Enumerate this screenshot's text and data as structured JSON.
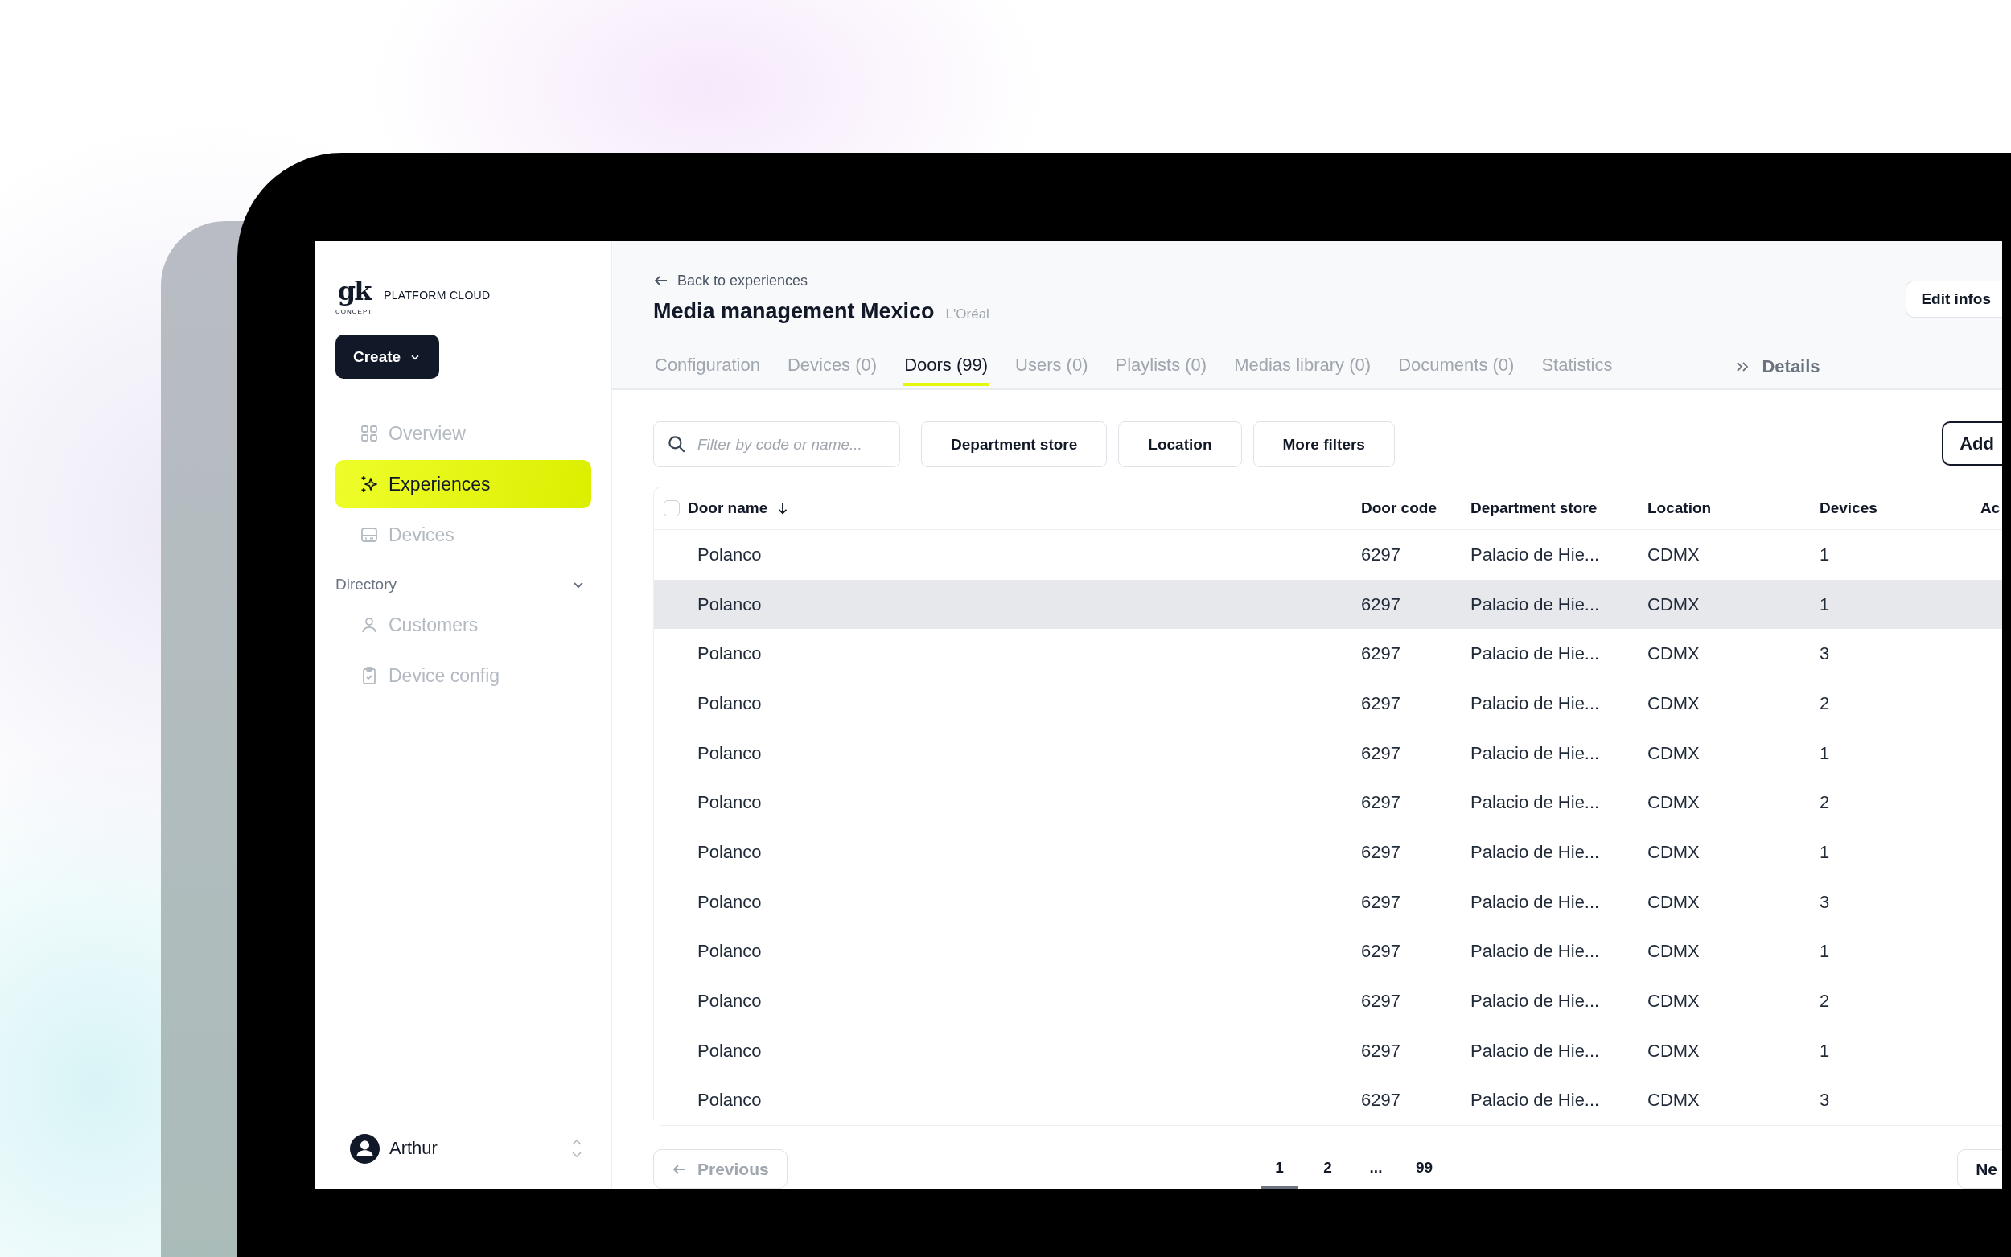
{
  "sidebar": {
    "logo": {
      "mark": "gk",
      "sub": "CONCEPT",
      "product": "PLATFORM CLOUD"
    },
    "create_button": "Create",
    "nav": [
      {
        "label": "Overview",
        "selected": false
      },
      {
        "label": "Experiences",
        "selected": true
      },
      {
        "label": "Devices",
        "selected": false
      }
    ],
    "section": {
      "label": "Directory",
      "expanded": true,
      "items": [
        {
          "label": "Customers",
          "selected": false
        },
        {
          "label": "Device config",
          "selected": false
        }
      ]
    },
    "user": {
      "name": "Arthur"
    }
  },
  "header": {
    "back_link": "Back to experiences",
    "title": "Media management Mexico",
    "subtitle": "L'Oréal",
    "edit_button": "Edit infos",
    "tabs": [
      {
        "label": "Configuration",
        "selected": false
      },
      {
        "label": "Devices (0)",
        "selected": false
      },
      {
        "label": "Doors (99)",
        "selected": true
      },
      {
        "label": "Users (0)",
        "selected": false
      },
      {
        "label": "Playlists (0)",
        "selected": false
      },
      {
        "label": "Medias library (0)",
        "selected": false
      },
      {
        "label": "Documents (0)",
        "selected": false
      },
      {
        "label": "Statistics",
        "selected": false
      }
    ],
    "details": "Details"
  },
  "filters": {
    "search": {
      "placeholder": "Filter by code or name..."
    },
    "buttons": [
      "Department store",
      "Location",
      "More filters"
    ],
    "add_button": "Add"
  },
  "table": {
    "select_all": {
      "checked": false
    },
    "columns": [
      {
        "label": "Door name",
        "sorted": true
      },
      {
        "label": "Door code",
        "sorted": false
      },
      {
        "label": "Department store",
        "sorted": false
      },
      {
        "label": "Location",
        "sorted": false
      },
      {
        "label": "Devices",
        "sorted": false
      },
      {
        "label": "Ac",
        "sorted": false
      }
    ],
    "rows": [
      {
        "cells": [
          "Polanco",
          "6297",
          "Palacio de Hie...",
          "CDMX",
          "1"
        ],
        "highlighted": false
      },
      {
        "cells": [
          "Polanco",
          "6297",
          "Palacio de Hie...",
          "CDMX",
          "1"
        ],
        "highlighted": true
      },
      {
        "cells": [
          "Polanco",
          "6297",
          "Palacio de Hie...",
          "CDMX",
          "3"
        ],
        "highlighted": false
      },
      {
        "cells": [
          "Polanco",
          "6297",
          "Palacio de Hie...",
          "CDMX",
          "2"
        ],
        "highlighted": false
      },
      {
        "cells": [
          "Polanco",
          "6297",
          "Palacio de Hie...",
          "CDMX",
          "1"
        ],
        "highlighted": false
      },
      {
        "cells": [
          "Polanco",
          "6297",
          "Palacio de Hie...",
          "CDMX",
          "2"
        ],
        "highlighted": false
      },
      {
        "cells": [
          "Polanco",
          "6297",
          "Palacio de Hie...",
          "CDMX",
          "1"
        ],
        "highlighted": false
      },
      {
        "cells": [
          "Polanco",
          "6297",
          "Palacio de Hie...",
          "CDMX",
          "3"
        ],
        "highlighted": false
      },
      {
        "cells": [
          "Polanco",
          "6297",
          "Palacio de Hie...",
          "CDMX",
          "1"
        ],
        "highlighted": false
      },
      {
        "cells": [
          "Polanco",
          "6297",
          "Palacio de Hie...",
          "CDMX",
          "2"
        ],
        "highlighted": false
      },
      {
        "cells": [
          "Polanco",
          "6297",
          "Palacio de Hie...",
          "CDMX",
          "1"
        ],
        "highlighted": false
      },
      {
        "cells": [
          "Polanco",
          "6297",
          "Palacio de Hie...",
          "CDMX",
          "3"
        ],
        "highlighted": false
      }
    ]
  },
  "pagination": {
    "previous": {
      "label": "Previous",
      "disabled": true
    },
    "pages": [
      {
        "label": "1",
        "selected": true
      },
      {
        "label": "2",
        "selected": false
      },
      {
        "label": "...",
        "selected": false
      },
      {
        "label": "99",
        "selected": false
      }
    ],
    "next": "Ne"
  }
}
